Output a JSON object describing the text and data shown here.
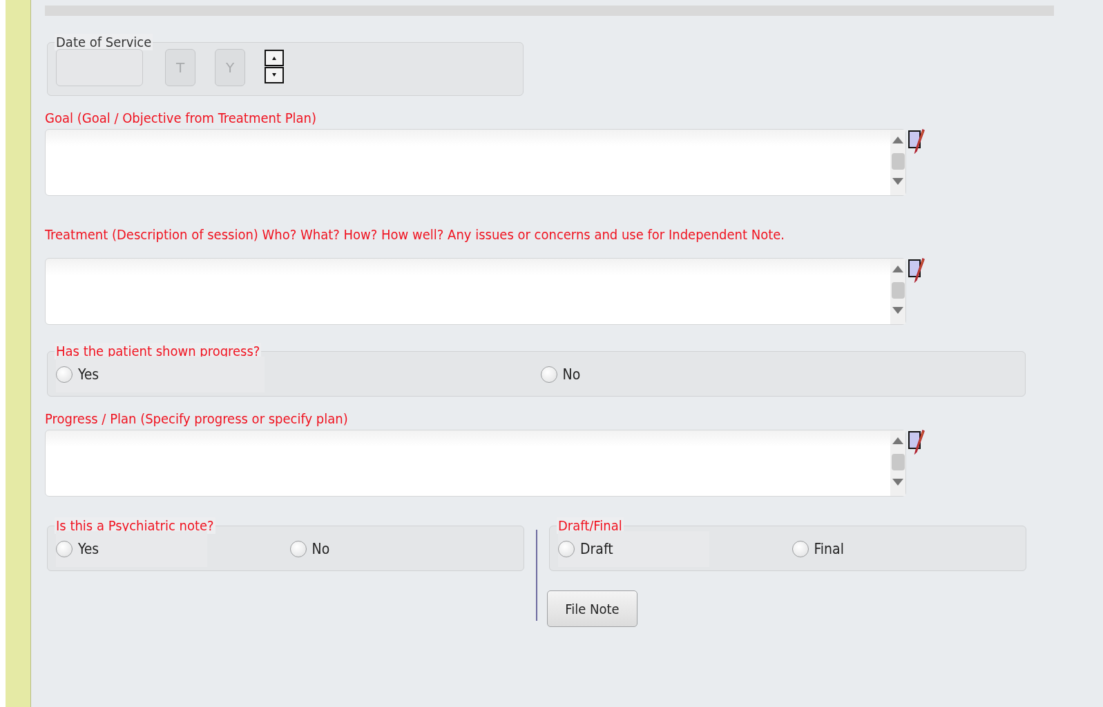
{
  "date_of_service": {
    "label": "Date of Service",
    "buttons": [
      {
        "label": "T",
        "disabled": true
      },
      {
        "label": "Y",
        "disabled": true
      }
    ]
  },
  "sections": [
    {
      "kind": "textarea",
      "label": "Goal (Goal / Objective from Treatment Plan)"
    },
    {
      "kind": "textarea",
      "label": "Treatment (Description of session) Who? What? How? How well? Any issues or concerns and use for Independent Note."
    },
    {
      "kind": "radio_group",
      "label": "Has the patient shown progress?",
      "options": [
        {
          "label": "Yes",
          "selected": false
        },
        {
          "label": "No",
          "selected": false
        }
      ]
    },
    {
      "kind": "textarea",
      "label": "Progress / Plan (Specify progress or specify plan)"
    }
  ],
  "psychiatric": {
    "label": "Is this a Psychiatric note?",
    "options": [
      {
        "label": "Yes",
        "selected": false
      },
      {
        "label": "No",
        "selected": false
      }
    ]
  },
  "draft_final": {
    "label": "Draft/Final",
    "options": [
      {
        "label": "Draft",
        "selected": false
      },
      {
        "label": "Final",
        "selected": false
      }
    ]
  },
  "file_note_button": "File Note"
}
